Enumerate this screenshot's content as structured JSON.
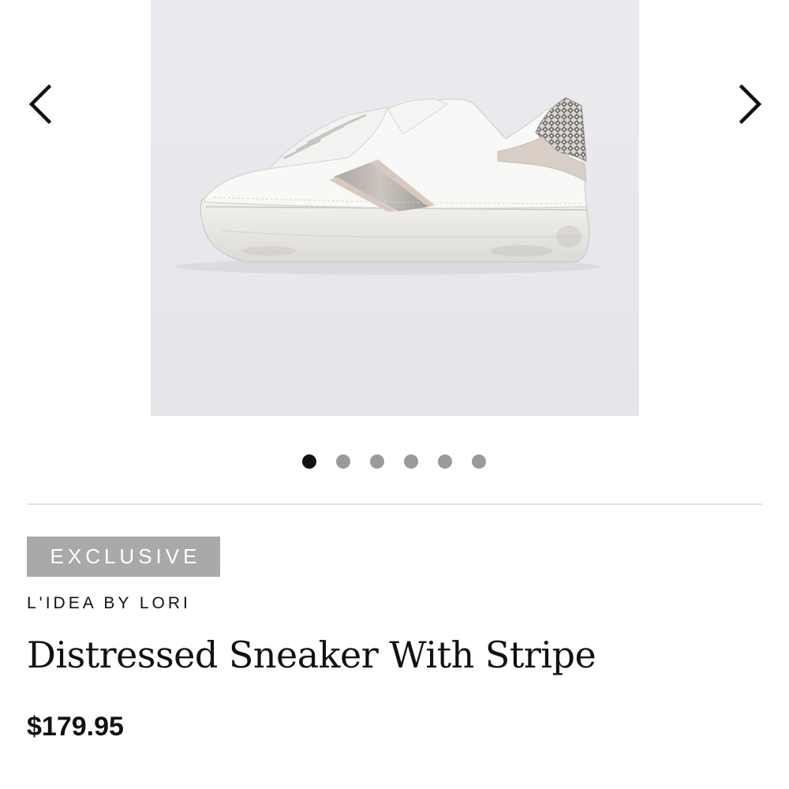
{
  "carousel": {
    "prev_icon": "chevron-left-icon",
    "next_icon": "chevron-right-icon",
    "image_alt": "Distressed Sneaker With Stripe",
    "slide_count": 6,
    "active_slide": 1
  },
  "product": {
    "badge": "EXCLUSIVE",
    "brand": "L'IDEA BY LORI",
    "title": "Distressed Sneaker With Stripe",
    "price": "$179.95"
  },
  "colors": {
    "badge_bg": "#a9a9a9",
    "dot_active": "#111111",
    "dot_inactive": "#9a9a9a",
    "image_bg": "#e9e9ed"
  }
}
